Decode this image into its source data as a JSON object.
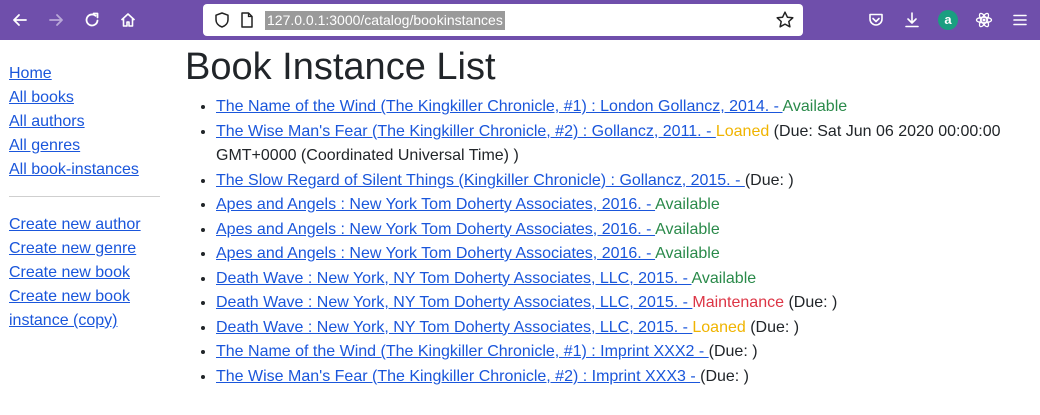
{
  "browser": {
    "url": "127.0.0.1:3000/catalog/bookinstances",
    "extension_badge": "a",
    "icons": [
      "back-icon",
      "forward-icon",
      "reload-icon",
      "home-icon",
      "shield-icon",
      "page-icon",
      "bookmark-star-icon",
      "pocket-icon",
      "download-icon",
      "extension-a-icon",
      "react-devtools-icon",
      "menu-icon"
    ]
  },
  "sidebar": {
    "links": [
      "Home",
      "All books",
      "All authors",
      "All genres",
      "All book-instances"
    ],
    "create_links": [
      "Create new author",
      "Create new genre",
      "Create new book",
      "Create new book",
      "instance (copy)"
    ]
  },
  "main": {
    "title": "Book Instance List",
    "items": [
      {
        "link": "The Name of the Wind (The Kingkiller Chronicle, #1) : London Gollancz, 2014. - ",
        "status": "Available",
        "due": ""
      },
      {
        "link": "The Wise Man's Fear (The Kingkiller Chronicle, #2) : Gollancz, 2011. - ",
        "status": "Loaned",
        "due": " (Due: Sat Jun 06 2020 00:00:00 GMT+0000 (Coordinated Universal Time) )"
      },
      {
        "link": "The Slow Regard of Silent Things (Kingkiller Chronicle) : Gollancz, 2015. - ",
        "status": "",
        "due": "(Due: )"
      },
      {
        "link": "Apes and Angels : New York Tom Doherty Associates, 2016. - ",
        "status": "Available",
        "due": ""
      },
      {
        "link": "Apes and Angels : New York Tom Doherty Associates, 2016. - ",
        "status": "Available",
        "due": ""
      },
      {
        "link": "Apes and Angels : New York Tom Doherty Associates, 2016. - ",
        "status": "Available",
        "due": ""
      },
      {
        "link": "Death Wave : New York, NY Tom Doherty Associates, LLC, 2015. - ",
        "status": "Available",
        "due": ""
      },
      {
        "link": "Death Wave : New York, NY Tom Doherty Associates, LLC, 2015. - ",
        "status": "Maintenance",
        "due": " (Due: )"
      },
      {
        "link": "Death Wave : New York, NY Tom Doherty Associates, LLC, 2015. - ",
        "status": "Loaned",
        "due": " (Due: )"
      },
      {
        "link": "The Name of the Wind (The Kingkiller Chronicle, #1) : Imprint XXX2 - ",
        "status": "",
        "due": "(Due: )"
      },
      {
        "link": "The Wise Man's Fear (The Kingkiller Chronicle, #2) : Imprint XXX3 - ",
        "status": "",
        "due": "(Due: )"
      }
    ]
  },
  "colors": {
    "toolbar": "#6f4fab",
    "link": "#1a56db",
    "available": "#2a8a4a",
    "loaned": "#f0b400",
    "maintenance": "#dc3545"
  }
}
